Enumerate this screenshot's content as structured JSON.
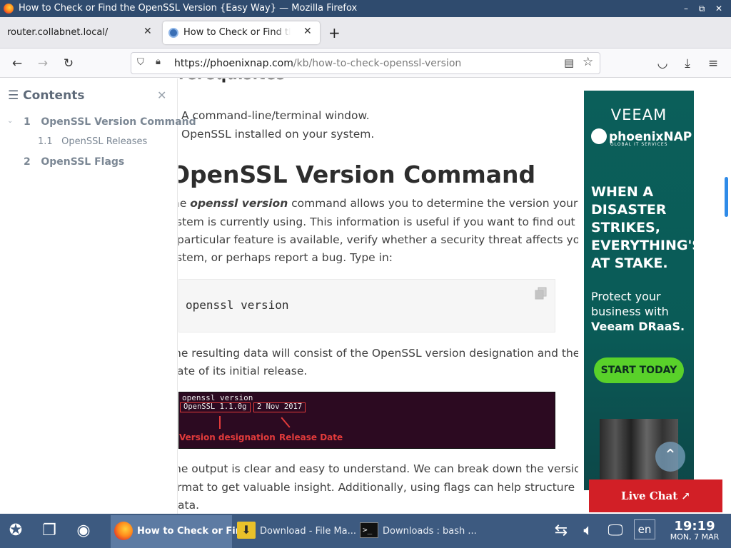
{
  "window": {
    "title": "How to Check or Find the OpenSSL Version {Easy Way} — Mozilla Firefox",
    "controls": {
      "minimize": "–",
      "maximize": "⧉",
      "close": "✕"
    }
  },
  "tabs": [
    {
      "label": "router.collabnet.local/"
    },
    {
      "label": "How to Check or Find the OpenSSL Version {Easy Way}"
    }
  ],
  "navbar": {
    "url_host": "https://phoenixnap.com",
    "url_path": "/kb/how-to-check-openssl-version"
  },
  "toc": {
    "title": "Contents",
    "items": [
      {
        "num": "1",
        "label": "OpenSSL Version Command"
      },
      {
        "num": "1.1",
        "label": "OpenSSL Releases"
      },
      {
        "num": "2",
        "label": "OpenSSL Flags"
      }
    ]
  },
  "article": {
    "prereq_heading": "rerequisites",
    "prereq_items": [
      "A command-line/terminal window.",
      "OpenSSL installed on your system."
    ],
    "section_heading": "OpenSSL Version Command",
    "para1_prefix": "he ",
    "para1_emph": "openssl version",
    "para1_lines": [
      " command allows you to determine the version your",
      "stem is currently using. This information is useful if you want to find out if",
      "particular feature is available, verify whether a security threat affects your",
      "stem, or perhaps report a bug. Type in:"
    ],
    "code": "openssl version",
    "para2_lines": [
      "he resulting data will consist of the OpenSSL version designation and the",
      "ate of its initial release."
    ],
    "terminal": {
      "command": "openssl version",
      "version_box": "OpenSSL 1.1.0g",
      "date_box": "2 Nov 2017",
      "label_version": "Version designation",
      "label_date": "Release Date"
    },
    "para3_lines": [
      "he output is clear and easy to understand. We can break down the version",
      "rmat to get valuable insight. Additionally, using flags can help structure the",
      "ata."
    ]
  },
  "ad": {
    "brand": "VEEAM",
    "partner": "phoenixNAP",
    "partner_sub": "GLOBAL IT SERVICES",
    "headline": [
      "WHEN A",
      "DISASTER",
      "STRIKES,",
      "EVERYTHING'S",
      "AT STAKE."
    ],
    "sub1": "Protect your",
    "sub2": "business with",
    "sub3": "Veeam DRaaS.",
    "cta": "START TODAY"
  },
  "live_chat": "Live Chat ↗",
  "taskbar": {
    "tasks": [
      {
        "label": "How to Check or Fin..."
      },
      {
        "label": "Download - File Ma..."
      },
      {
        "label": "Downloads : bash ..."
      }
    ],
    "lang": "en",
    "time": "19:19",
    "date": "MON, 7 MAR"
  },
  "colors": {
    "titlebar": "#2f4b6e",
    "taskbar": "#3d5a80",
    "ad_bg": "#0b5f5a",
    "cta": "#59d12a",
    "live_chat": "#d21f26",
    "terminal_bg": "#2c0a21",
    "annotation": "#e23b3b"
  }
}
